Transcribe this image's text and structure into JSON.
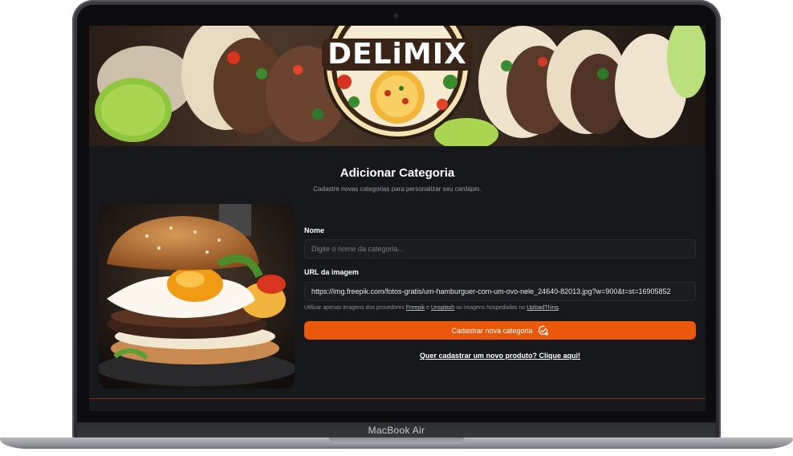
{
  "device": {
    "label": "MacBook Air"
  },
  "banner": {
    "logo_text": "DELiMIX"
  },
  "page": {
    "title": "Adicionar Categoria",
    "subtitle": "Cadastre novas categorias para personalizar seu cardápio."
  },
  "form": {
    "name_label": "Nome",
    "name_placeholder": "Digite o nome da categoria...",
    "url_label": "URL da imagem",
    "url_value": "https://img.freepik.com/fotos-gratis/um-hamburguer-com-um-ovo-nele_24640-82013.jpg?w=900&t=st=16905852",
    "hint_prefix": "Utilizar apenas imagens dos provedores",
    "hint_freepik": "Freepik",
    "hint_and": "e",
    "hint_unsplash": "Unsplash",
    "hint_middle": "ou imagens hospedadas no",
    "hint_uploadthing": "UploadThing",
    "hint_end": ".",
    "submit_label": "Cadastrar nova categoria",
    "submit_icon": "check-plus-icon",
    "product_link": "Quer cadastrar um novo produto? Clique aqui!"
  },
  "colors": {
    "accent": "#ea580c",
    "background": "#17181c",
    "input_bg": "#1c1d21"
  }
}
